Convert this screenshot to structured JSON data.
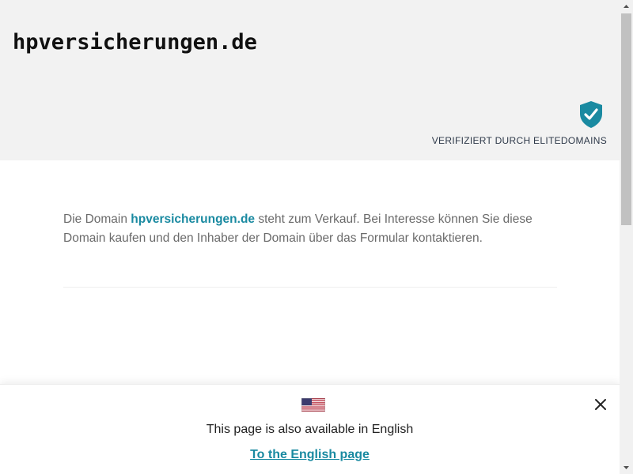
{
  "header": {
    "site_title": "hpversicherungen.de",
    "verified_label": "VERIFIZIERT DURCH ELITEDOMAINS",
    "verified_icon": "shield-check-icon"
  },
  "main": {
    "description_prefix": "Die Domain ",
    "domain": "hpversicherungen.de",
    "description_suffix": " steht zum Verkauf. Bei Interesse können Sie diese Domain kaufen und den Inhaber der Domain über das Formular kontaktieren."
  },
  "language_banner": {
    "flag_icon": "us-flag-icon",
    "text": "This page is also available in English",
    "link_label": "To the English page",
    "close_icon": "close-icon"
  },
  "colors": {
    "accent": "#1a8aa1",
    "header_bg": "#f2f2f2",
    "shield": "#1a8aa1"
  }
}
